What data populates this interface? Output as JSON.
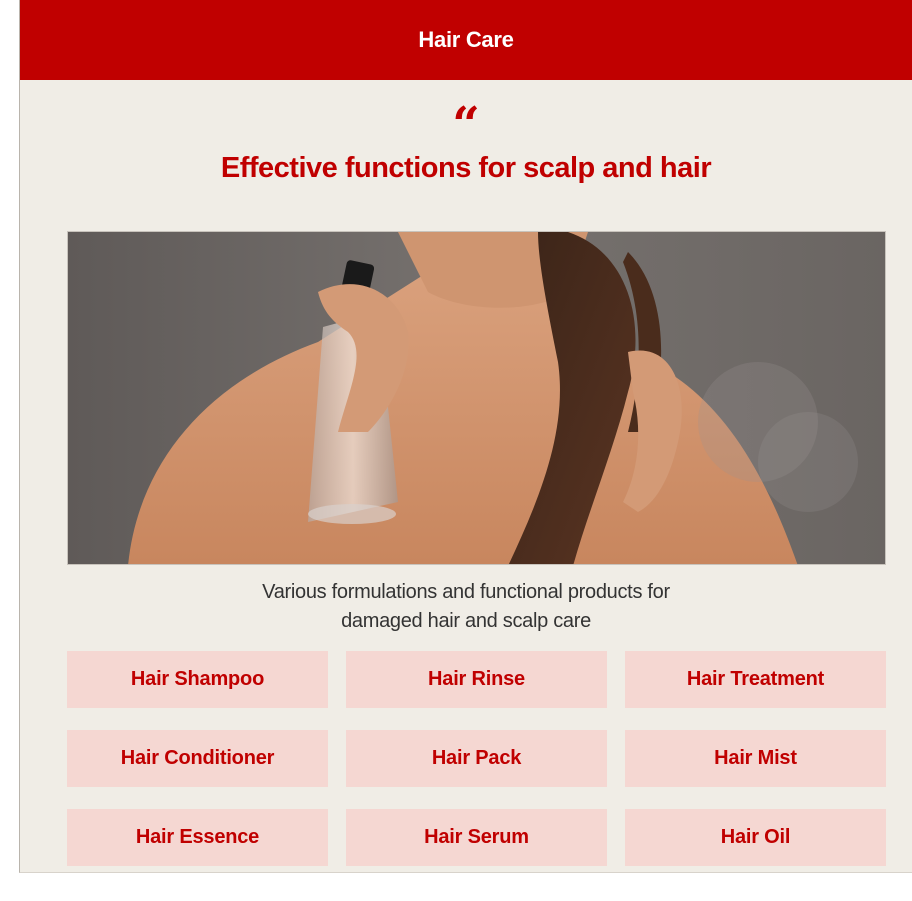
{
  "header": {
    "title": "Hair Care"
  },
  "quote": {
    "mark": "“"
  },
  "headline": "Effective functions for scalp and hair",
  "hero": {
    "image": "woman spraying hair mist on long hair"
  },
  "description": {
    "line1": "Various formulations and functional products for",
    "line2": "damaged hair and scalp care"
  },
  "products": [
    {
      "label": "Hair Shampoo"
    },
    {
      "label": "Hair Rinse"
    },
    {
      "label": "Hair Treatment"
    },
    {
      "label": "Hair Conditioner"
    },
    {
      "label": "Hair Pack"
    },
    {
      "label": "Hair Mist"
    },
    {
      "label": "Hair Essence"
    },
    {
      "label": "Hair Serum"
    },
    {
      "label": "Hair Oil"
    }
  ],
  "colors": {
    "accent": "#c00000",
    "panel_background": "#f0ede6",
    "button_background": "#f5d7d2",
    "body_text": "#333333"
  }
}
